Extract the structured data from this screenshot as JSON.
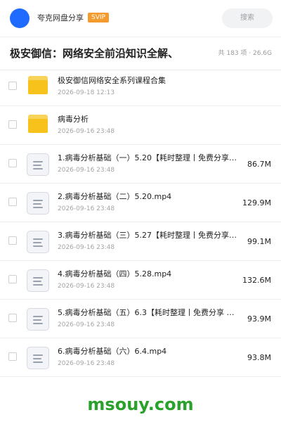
{
  "header": {
    "app_name": "夸克网盘分享",
    "badge": "SVIP",
    "search_placeholder": "搜索"
  },
  "folder": {
    "title": "极安御信：网络安全前沿知识全解、",
    "meta": "共 183 项 · 26.6G"
  },
  "icons": {
    "folder": "folder-icon",
    "file": "document-icon"
  },
  "colors": {
    "avatar": "#1f6bff",
    "svip_badge": "#f39b2f",
    "folder": "#f6c21b",
    "watermark": "#2aa12a"
  },
  "files": [
    {
      "type": "folder",
      "name": "极安御信网络安全系列课程合集",
      "date": "2026-09-18 12:13",
      "size": ""
    },
    {
      "type": "folder",
      "name": "病毒分析",
      "date": "2026-09-16 23:48",
      "size": ""
    },
    {
      "type": "file",
      "name": "1.病毒分析基础（一）5.20【耗时整理丨免费分享丨…",
      "date": "2026-09-16 23:48",
      "size": "86.7M"
    },
    {
      "type": "file",
      "name": "2.病毒分析基础（二）5.20.mp4",
      "date": "2026-09-16 23:48",
      "size": "129.9M"
    },
    {
      "type": "file",
      "name": "3.病毒分析基础（三）5.27【耗时整理丨免费分享丨…",
      "date": "2026-09-16 23:48",
      "size": "99.1M"
    },
    {
      "type": "file",
      "name": "4.病毒分析基础（四）5.28.mp4",
      "date": "2026-09-16 23:48",
      "size": "132.6M"
    },
    {
      "type": "file",
      "name": "5.病毒分析基础（五）6.3【耗时整理丨免费分享 …",
      "date": "2026-09-16 23:48",
      "size": "93.9M"
    },
    {
      "type": "file",
      "name": "6.病毒分析基础（六）6.4.mp4",
      "date": "2026-09-16 23:48",
      "size": "93.8M"
    }
  ],
  "watermark": "msouy.com"
}
